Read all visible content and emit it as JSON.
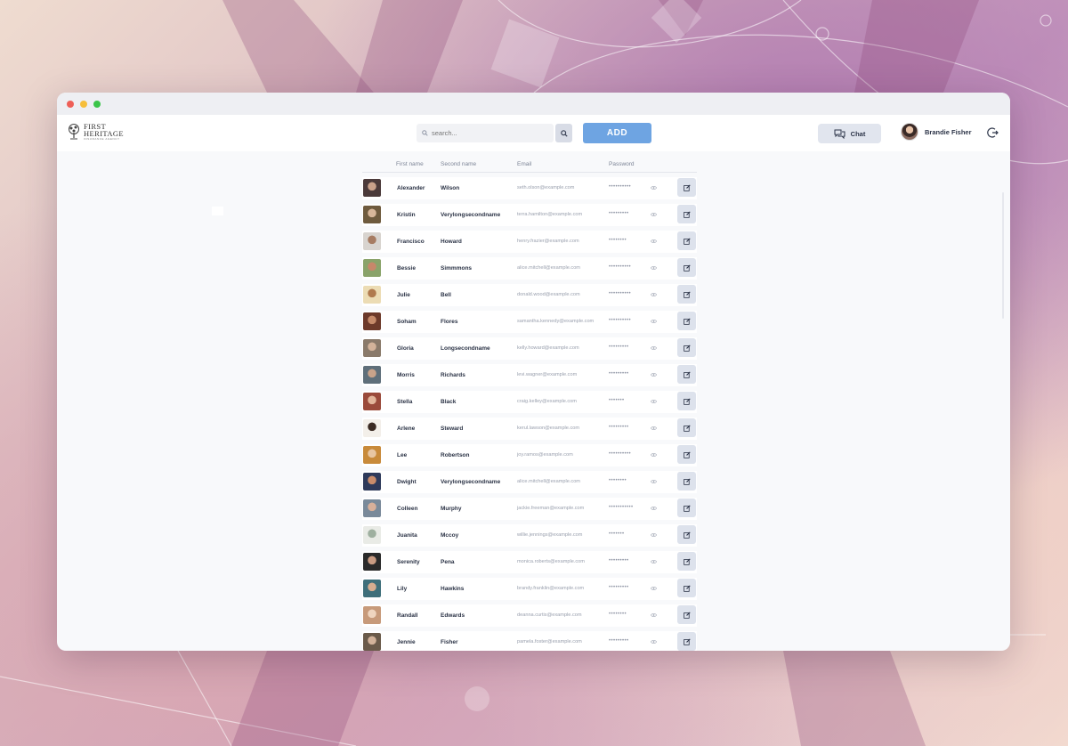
{
  "header": {
    "logo_line1": "FIRST",
    "logo_line2": "HERITAGE",
    "logo_line3": "INSURANCE AGENCY",
    "search_placeholder": "search...",
    "add_label": "ADD",
    "chat_label": "Chat",
    "user_name": "Brandie Fisher"
  },
  "table": {
    "columns": {
      "first_name": "First name",
      "second_name": "Second name",
      "email": "Email",
      "password": "Password"
    },
    "rows": [
      {
        "first": "Alexander",
        "second": "Wilson",
        "email": "seth.olson@example.com",
        "password": "••••••••••",
        "avatar_colors": [
          "#4b3a3a",
          "#c9a18a"
        ]
      },
      {
        "first": "Kristin",
        "second": "Verylongsecondname",
        "email": "terra.hamilton@example.com",
        "password": "•••••••••",
        "avatar_colors": [
          "#6f5b3e",
          "#d8b79a"
        ]
      },
      {
        "first": "Francisco",
        "second": "Howard",
        "email": "henry.frazier@example.com",
        "password": "••••••••",
        "avatar_colors": [
          "#d8d4cf",
          "#a77c62"
        ]
      },
      {
        "first": "Bessie",
        "second": "Simmmons",
        "email": "alice.mitchell@example.com",
        "password": "••••••••••",
        "avatar_colors": [
          "#8aa36a",
          "#c7876a"
        ]
      },
      {
        "first": "Julie",
        "second": "Bell",
        "email": "donald.wood@example.com",
        "password": "••••••••••",
        "avatar_colors": [
          "#ecdcb4",
          "#b07a4e"
        ]
      },
      {
        "first": "Soham",
        "second": "Flores",
        "email": "samantha.kennedy@example.com",
        "password": "••••••••••",
        "avatar_colors": [
          "#6d3a2a",
          "#c68b6a"
        ]
      },
      {
        "first": "Gloria",
        "second": "Longsecondname",
        "email": "kelly.howard@example.com",
        "password": "•••••••••",
        "avatar_colors": [
          "#8a7a6a",
          "#d3b39a"
        ]
      },
      {
        "first": "Morris",
        "second": "Richards",
        "email": "levi.wagner@example.com",
        "password": "•••••••••",
        "avatar_colors": [
          "#5f6f7a",
          "#c9a38a"
        ]
      },
      {
        "first": "Stella",
        "second": "Black",
        "email": "craig.kelley@example.com",
        "password": "•••••••",
        "avatar_colors": [
          "#9a4a3a",
          "#e2b59a"
        ]
      },
      {
        "first": "Arlene",
        "second": "Steward",
        "email": "kerul.lawson@example.com",
        "password": "•••••••••",
        "avatar_colors": [
          "#f3efe9",
          "#3a2a22"
        ]
      },
      {
        "first": "Lee",
        "second": "Robertson",
        "email": "joy.ramos@example.com",
        "password": "••••••••••",
        "avatar_colors": [
          "#c88a3a",
          "#e8c6a2"
        ]
      },
      {
        "first": "Dwight",
        "second": "Verylongsecondname",
        "email": "alice.mitchell@example.com",
        "password": "••••••••",
        "avatar_colors": [
          "#2e3a5a",
          "#c98c6a"
        ]
      },
      {
        "first": "Colleen",
        "second": "Murphy",
        "email": "jackie.freeman@example.com",
        "password": "•••••••••••",
        "avatar_colors": [
          "#7a8a9a",
          "#d8b09a"
        ]
      },
      {
        "first": "Juanita",
        "second": "Mccoy",
        "email": "willie.jennings@example.com",
        "password": "•••••••",
        "avatar_colors": [
          "#e9ebe6",
          "#9fb0a0"
        ]
      },
      {
        "first": "Serenity",
        "second": "Pena",
        "email": "monica.roberts@example.com",
        "password": "•••••••••",
        "avatar_colors": [
          "#2a2a2a",
          "#c99b82"
        ]
      },
      {
        "first": "Lily",
        "second": "Hawkins",
        "email": "brandy.franklin@example.com",
        "password": "•••••••••",
        "avatar_colors": [
          "#3f6f7a",
          "#d6ad90"
        ]
      },
      {
        "first": "Randall",
        "second": "Edwards",
        "email": "deanna.curtis@example.com",
        "password": "••••••••",
        "avatar_colors": [
          "#c79a7a",
          "#efd5bf"
        ]
      },
      {
        "first": "Jennie",
        "second": "Fisher",
        "email": "pamela.foster@example.com",
        "password": "•••••••••",
        "avatar_colors": [
          "#6a5a4a",
          "#d2b29a"
        ]
      }
    ]
  }
}
